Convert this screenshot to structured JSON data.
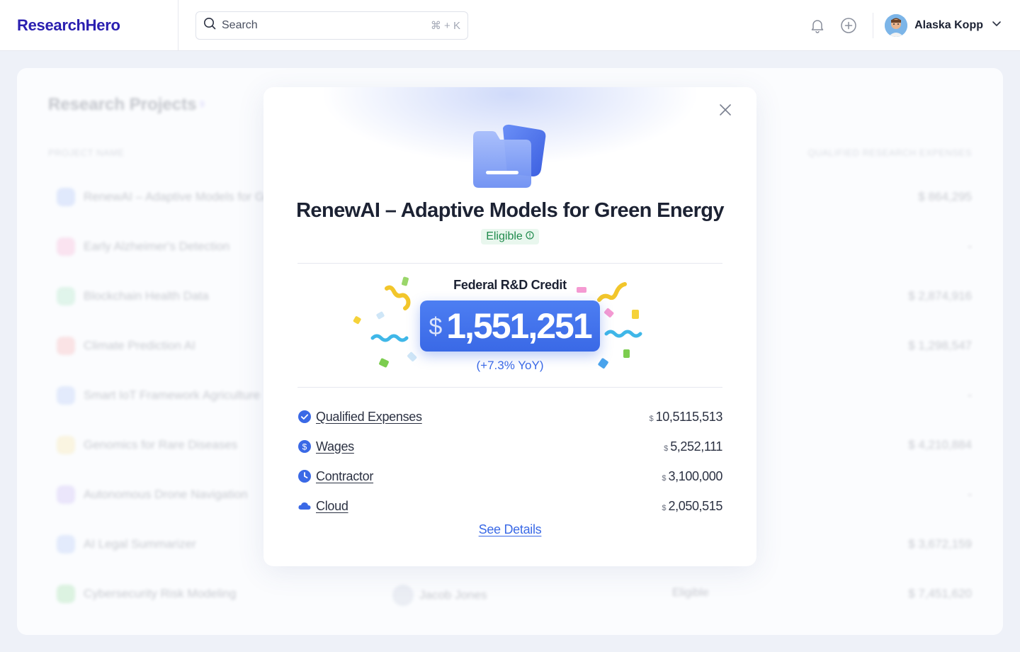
{
  "header": {
    "brand": "ResearchHero",
    "search_placeholder": "Search",
    "search_shortcut": "⌘ + K",
    "user_name": "Alaska Kopp"
  },
  "background": {
    "title": "Research Projects",
    "count": "9",
    "col_project": "PROJECT NAME",
    "col_qre": "QUALIFIED RESEARCH EXPENSES",
    "rows": [
      {
        "name": "RenewAI – Adaptive Models for Green Energy",
        "amount": "$ 864,295",
        "color": "#8fb0f5"
      },
      {
        "name": "Early Alzheimer's Detection",
        "amount": "-",
        "color": "#f59ac7"
      },
      {
        "name": "Blockchain Health Data",
        "amount": "$ 2,874,916",
        "color": "#8fe0b0"
      },
      {
        "name": "Climate Prediction AI",
        "amount": "$ 1,298,547",
        "color": "#f59a9a"
      },
      {
        "name": "Smart IoT Framework Agriculture",
        "amount": "-",
        "color": "#9ab8f5"
      },
      {
        "name": "Genomics for Rare Diseases",
        "amount": "$ 4,210,884",
        "color": "#f5e08a"
      },
      {
        "name": "Autonomous Drone Navigation",
        "amount": "-",
        "color": "#b8a4f2"
      },
      {
        "name": "AI Legal Summarizer",
        "amount": "$ 3,672,159",
        "color": "#9ab8f5"
      },
      {
        "name": "Cybersecurity Risk Modeling",
        "amount": "$ 7,451,620",
        "color": "#7fd88a",
        "person": "Jacob Jones",
        "status": "Eligible"
      }
    ]
  },
  "modal": {
    "title": "RenewAI – Adaptive Models for Green Energy",
    "badge": "Eligible",
    "credit_label": "Federal R&D Credit",
    "credit_currency": "$",
    "credit_value": "1,551,251",
    "credit_yoy": "(+7.3% YoY)",
    "rows": [
      {
        "label": "Qualified Expenses",
        "currency": "$",
        "value": "10,5115,513",
        "icon": "check-circle-icon"
      },
      {
        "label": "Wages",
        "currency": "$",
        "value": "5,252,111",
        "icon": "dollar-circle-icon"
      },
      {
        "label": "Contractor",
        "currency": "$",
        "value": "3,100,000",
        "icon": "clock-icon"
      },
      {
        "label": "Cloud",
        "currency": "$",
        "value": "2,050,515",
        "icon": "cloud-icon"
      }
    ],
    "see_details": "See Details"
  },
  "colors": {
    "brand": "#2a1fb0",
    "accent": "#3a69e6",
    "eligible_bg": "#e9f7ee",
    "eligible_text": "#1f8a4c"
  }
}
